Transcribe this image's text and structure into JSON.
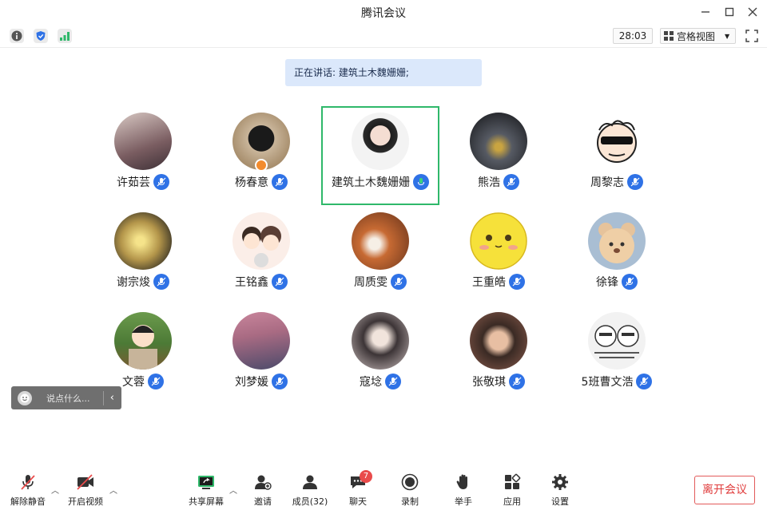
{
  "window": {
    "title": "腾讯会议"
  },
  "toolbar": {
    "timer": "28:03",
    "view_mode": "宫格视图"
  },
  "speaking": {
    "text": "正在讲话: 建筑土木魏姗姗;"
  },
  "participants": [
    {
      "name": "许茹芸"
    },
    {
      "name": "杨春意"
    },
    {
      "name": "建筑土木魏姗姗"
    },
    {
      "name": "熊浩"
    },
    {
      "name": "周黎志"
    },
    {
      "name": "谢宗焌"
    },
    {
      "name": "王铭鑫"
    },
    {
      "name": "周质雯"
    },
    {
      "name": "王重皓"
    },
    {
      "name": "徐锋"
    },
    {
      "name": "文蓉"
    },
    {
      "name": "刘梦媛"
    },
    {
      "name": "寇埝"
    },
    {
      "name": "张敬琪"
    },
    {
      "name": "5班曹文浩"
    }
  ],
  "chat": {
    "placeholder": "说点什么..."
  },
  "bottom": {
    "unmute": "解除静音",
    "video": "开启视频",
    "share": "共享屏幕",
    "invite": "邀请",
    "members": "成员(32)",
    "chat": "聊天",
    "chat_badge": "7",
    "record": "录制",
    "raise_hand": "举手",
    "apps": "应用",
    "settings": "设置",
    "leave": "离开会议"
  },
  "colors": {
    "active_border": "#2fb86a",
    "mic": "#2f72e6",
    "leave": "#e03c3c",
    "banner": "#dbe8fb"
  }
}
